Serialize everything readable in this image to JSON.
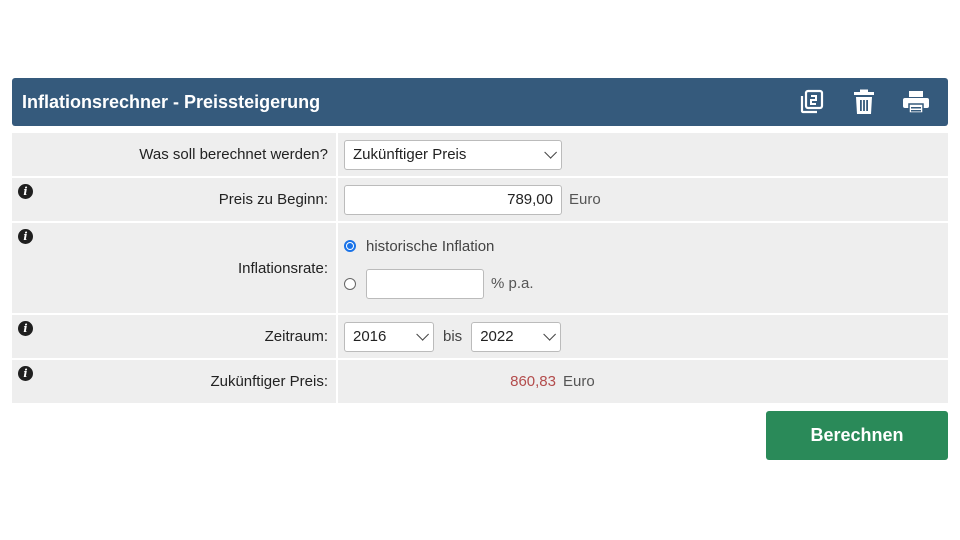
{
  "header": {
    "title": "Inflationsrechner - Preissteigerung",
    "icons": [
      "copy-icon",
      "trash-icon",
      "print-icon"
    ],
    "color": "#355a7c"
  },
  "rows": {
    "type": {
      "label": "Was soll berechnet werden?",
      "value": "Zukünftiger Preis"
    },
    "price": {
      "label": "Preis zu Beginn:",
      "value": "789,00",
      "unit": "Euro"
    },
    "rate": {
      "label": "Inflationsrate:",
      "option_historic": "historische Inflation",
      "option_custom_value": "",
      "option_custom_unit": "% p.a.",
      "selected": "historic"
    },
    "period": {
      "label": "Zeitraum:",
      "from": "2016",
      "separator": "bis",
      "to": "2022"
    },
    "result": {
      "label": "Zukünftiger Preis:",
      "value": "860,83",
      "unit": "Euro",
      "color": "#b34c4c"
    }
  },
  "actions": {
    "calculate_label": "Berechnen",
    "color": "#2a8a59"
  }
}
